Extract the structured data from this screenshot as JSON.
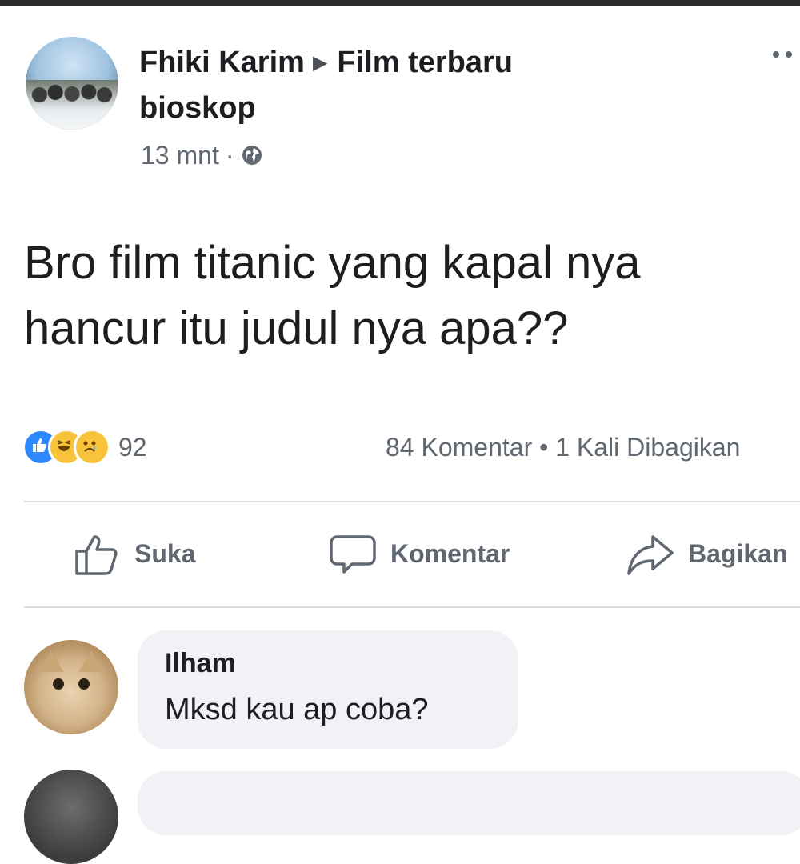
{
  "post": {
    "author": "Fhiki Karim",
    "group_line1": "Film terbaru",
    "group_line2": "bioskop",
    "time": "13 mnt",
    "text_line1": "Bro film titanic yang kapal nya",
    "text_line2": "hancur itu judul nya apa??",
    "reaction_count": "92",
    "stats": "84 Komentar • 1 Kali Dibagikan"
  },
  "actions": {
    "like_label": "Suka",
    "comment_label": "Komentar",
    "share_label": "Bagikan"
  },
  "comment": {
    "author": "Ilham",
    "text": "Mksd kau ap coba?"
  },
  "colors": {
    "like_blue": "#2d88ff",
    "reaction_yellow": "#f7c33b",
    "text_gray": "#606770",
    "bubble_bg": "#f0f2f5"
  },
  "icons": {
    "audience": "globe-icon",
    "like": "thumbs-up-icon",
    "comment": "speech-bubble-icon",
    "share": "share-arrow-icon"
  }
}
